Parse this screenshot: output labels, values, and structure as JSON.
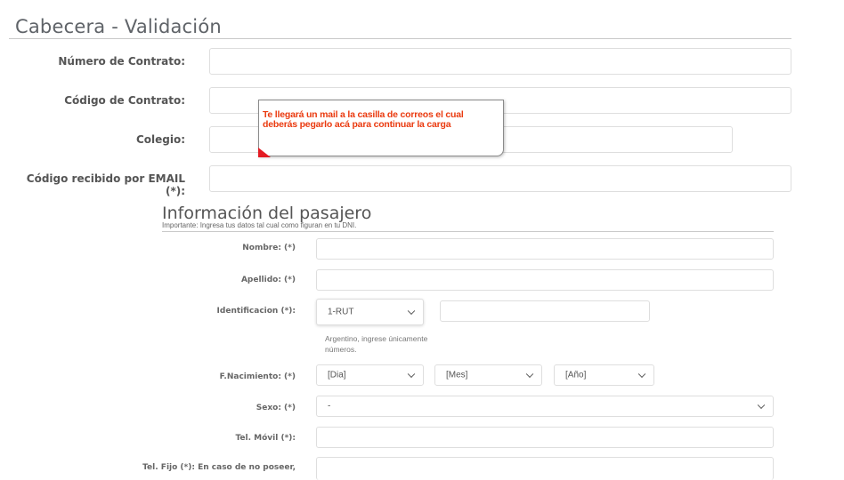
{
  "header": {
    "title": "Cabecera - Validación"
  },
  "contract": {
    "numero_label": "Número de Contrato:",
    "codigo_label": "Código de Contrato:",
    "colegio_label": "Colegio:",
    "email_code_label": "Código recibido por EMAIL (*):"
  },
  "tooltip": {
    "text": "Te llegará un mail a la casilla de correos el cual deberás pegarlo acá para continuar la carga",
    "color": "#ea3a0f"
  },
  "passenger": {
    "title": "Información del pasajero",
    "note": "Importante: Ingresa tus datos tal cual como figuran en tu DNI.",
    "nombre_label": "Nombre: (*)",
    "apellido_label": "Apellido: (*)",
    "identificacion_label": "Identificacion (*):",
    "identificacion_type": "1-RUT",
    "identificacion_hint": "Argentino, ingrese únicamente números.",
    "nacimiento_label": "F.Nacimiento: (*)",
    "dia": "[Dia]",
    "mes": "[Mes]",
    "anio": "[Año]",
    "sexo_label": "Sexo: (*)",
    "sexo_value": "-",
    "tel_movil_label": "Tel. Móvil (*):",
    "tel_fijo_label": "Tel. Fijo (*): En caso de no poseer,"
  },
  "icons": {
    "dropdown": "chevron-down-icon",
    "tooltip_pointer": "tooltip-arrow-icon"
  }
}
